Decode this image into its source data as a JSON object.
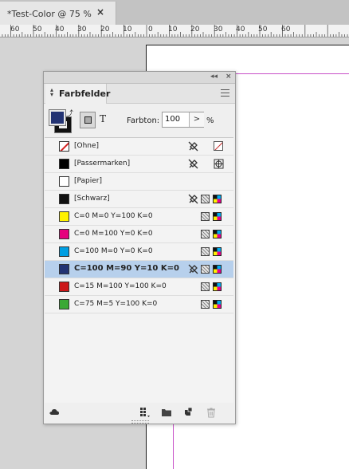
{
  "document_tab": {
    "title": "*Test-Color @ 75 %",
    "close": "×"
  },
  "ruler": {
    "labels": [
      "60",
      "50",
      "40",
      "30",
      "20",
      "10",
      "0",
      "10",
      "20",
      "30",
      "40",
      "50",
      "60"
    ]
  },
  "panel": {
    "title": "Farbfelder",
    "collapse_glyph": "◂◂",
    "close_glyph": "×",
    "tint_label": "Farbton:",
    "tint_value": "100",
    "tint_unit": "%",
    "tint_arrow": ">",
    "text_button": "T",
    "fill_color": "#233373",
    "stroke_color": "#111111"
  },
  "swatches": [
    {
      "label": "[Ohne]",
      "chip": "none",
      "icons": [
        "no-edit-icon",
        "none-icon"
      ]
    },
    {
      "label": "[Passermarken]",
      "color": "#000000",
      "icons": [
        "no-edit-icon",
        "registration-icon"
      ]
    },
    {
      "label": "[Papier]",
      "color": "#ffffff",
      "icons": []
    },
    {
      "label": "[Schwarz]",
      "color": "#111111",
      "icons": [
        "no-edit-icon",
        "process-icon",
        "cmyk-icon"
      ]
    },
    {
      "label": "C=0 M=0 Y=100 K=0",
      "color": "#fff200",
      "icons": [
        "process-icon",
        "cmyk-icon"
      ]
    },
    {
      "label": "C=0 M=100 Y=0 K=0",
      "color": "#e5007d",
      "icons": [
        "process-icon",
        "cmyk-icon"
      ]
    },
    {
      "label": "C=100 M=0 Y=0 K=0",
      "color": "#009fe3",
      "icons": [
        "process-icon",
        "cmyk-icon"
      ]
    },
    {
      "label": "C=100 M=90 Y=10 K=0",
      "color": "#233373",
      "selected": true,
      "icons": [
        "no-edit-icon",
        "process-icon",
        "cmyk-icon"
      ]
    },
    {
      "label": "C=15 M=100 Y=100 K=0",
      "color": "#cc1719",
      "icons": [
        "process-icon",
        "cmyk-icon"
      ]
    },
    {
      "label": "C=75 M=5 Y=100 K=0",
      "color": "#3aa935",
      "icons": [
        "process-icon",
        "cmyk-icon"
      ]
    }
  ],
  "bottom_toolbar": {
    "icons": [
      "cc-libraries-icon",
      "swatch-views-icon",
      "new-group-icon",
      "new-swatch-icon",
      "delete-icon"
    ]
  }
}
